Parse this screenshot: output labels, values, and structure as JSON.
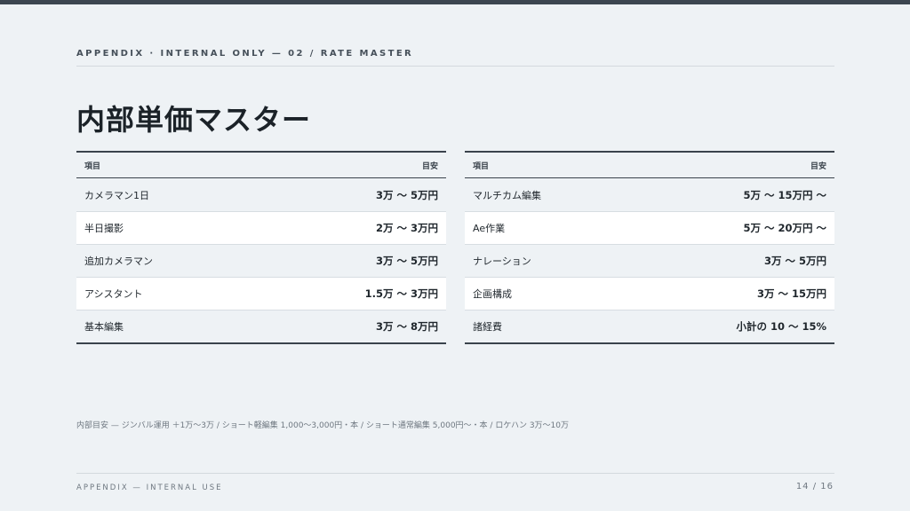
{
  "header": "APPENDIX · INTERNAL ONLY — 02 / RATE MASTER",
  "title": "内部単価マスター",
  "tables": [
    {
      "col_item": "項目",
      "col_value": "目安",
      "rows": [
        {
          "item": "カメラマン1日",
          "value": "3万 〜 5万円"
        },
        {
          "item": "半日撮影",
          "value": "2万 〜 3万円"
        },
        {
          "item": "追加カメラマン",
          "value": "3万 〜 5万円"
        },
        {
          "item": "アシスタント",
          "value": "1.5万 〜 3万円"
        },
        {
          "item": "基本編集",
          "value": "3万 〜 8万円"
        }
      ]
    },
    {
      "col_item": "項目",
      "col_value": "目安",
      "rows": [
        {
          "item": "マルチカム編集",
          "value": "5万 〜 15万円 〜"
        },
        {
          "item": "Ae作業",
          "value": "5万 〜 20万円 〜"
        },
        {
          "item": "ナレーション",
          "value": "3万 〜 5万円"
        },
        {
          "item": "企画構成",
          "value": "3万 〜 15万円"
        },
        {
          "item": "諸経費",
          "value": "小計の 10 〜 15%"
        }
      ]
    }
  ],
  "note": "内部目安 — ジンバル運用 ＋1万〜3万 / ショート軽編集 1,000〜3,000円・本 / ショート通常編集 5,000円〜・本 / ロケハン 3万〜10万",
  "footer": {
    "left": "APPENDIX — INTERNAL USE",
    "page": "14 / 16"
  }
}
